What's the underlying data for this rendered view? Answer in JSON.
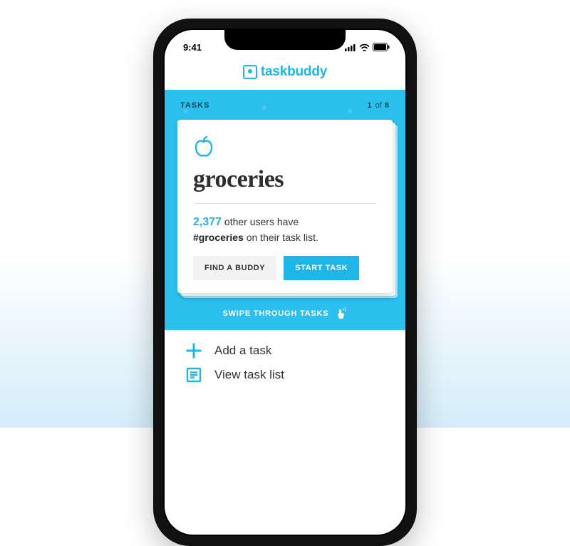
{
  "status": {
    "time": "9:41"
  },
  "app": {
    "name": "taskbuddy"
  },
  "tasks_section": {
    "label": "TASKS",
    "pager_current": "1",
    "pager_sep": "of",
    "pager_total": "8"
  },
  "card": {
    "title": "groceries",
    "stat_count": "2,377",
    "stat_rest": " other users have",
    "hashtag": "#groceries",
    "stat_tail": " on their task list.",
    "find_buddy_label": "FIND A BUDDY",
    "start_task_label": "START TASK"
  },
  "swipe_hint": "SWIPE THROUGH TASKS",
  "actions": {
    "add": "Add a task",
    "view": "View task list"
  },
  "colors": {
    "accent": "#1eb6e8",
    "panel": "#2cc0ee"
  }
}
